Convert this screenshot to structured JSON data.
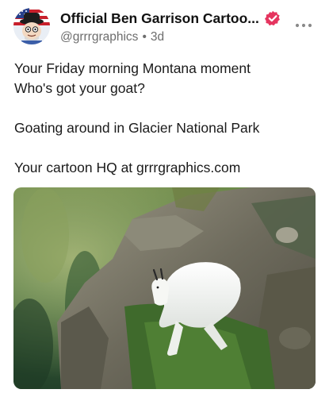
{
  "post": {
    "author": {
      "display_name": "Official  Ben Garrison Cartoo...",
      "handle": "@grrrgraphics",
      "separator": "•",
      "age": "3d",
      "verified": true,
      "verified_color": "#e5355f"
    },
    "body_lines": [
      "Your Friday morning Montana moment",
      "Who's got your goat?",
      "",
      "Goating around in Glacier National Park",
      "",
      "Your cartoon HQ at grrrgraphics.com"
    ],
    "media": {
      "type": "photo",
      "subject": "mountain goat resting on a grassy cliff ledge"
    }
  },
  "icons": {
    "avatar": "cartoon-avatar-icon",
    "verified": "verified-badge-icon",
    "more": "more-options-icon"
  }
}
